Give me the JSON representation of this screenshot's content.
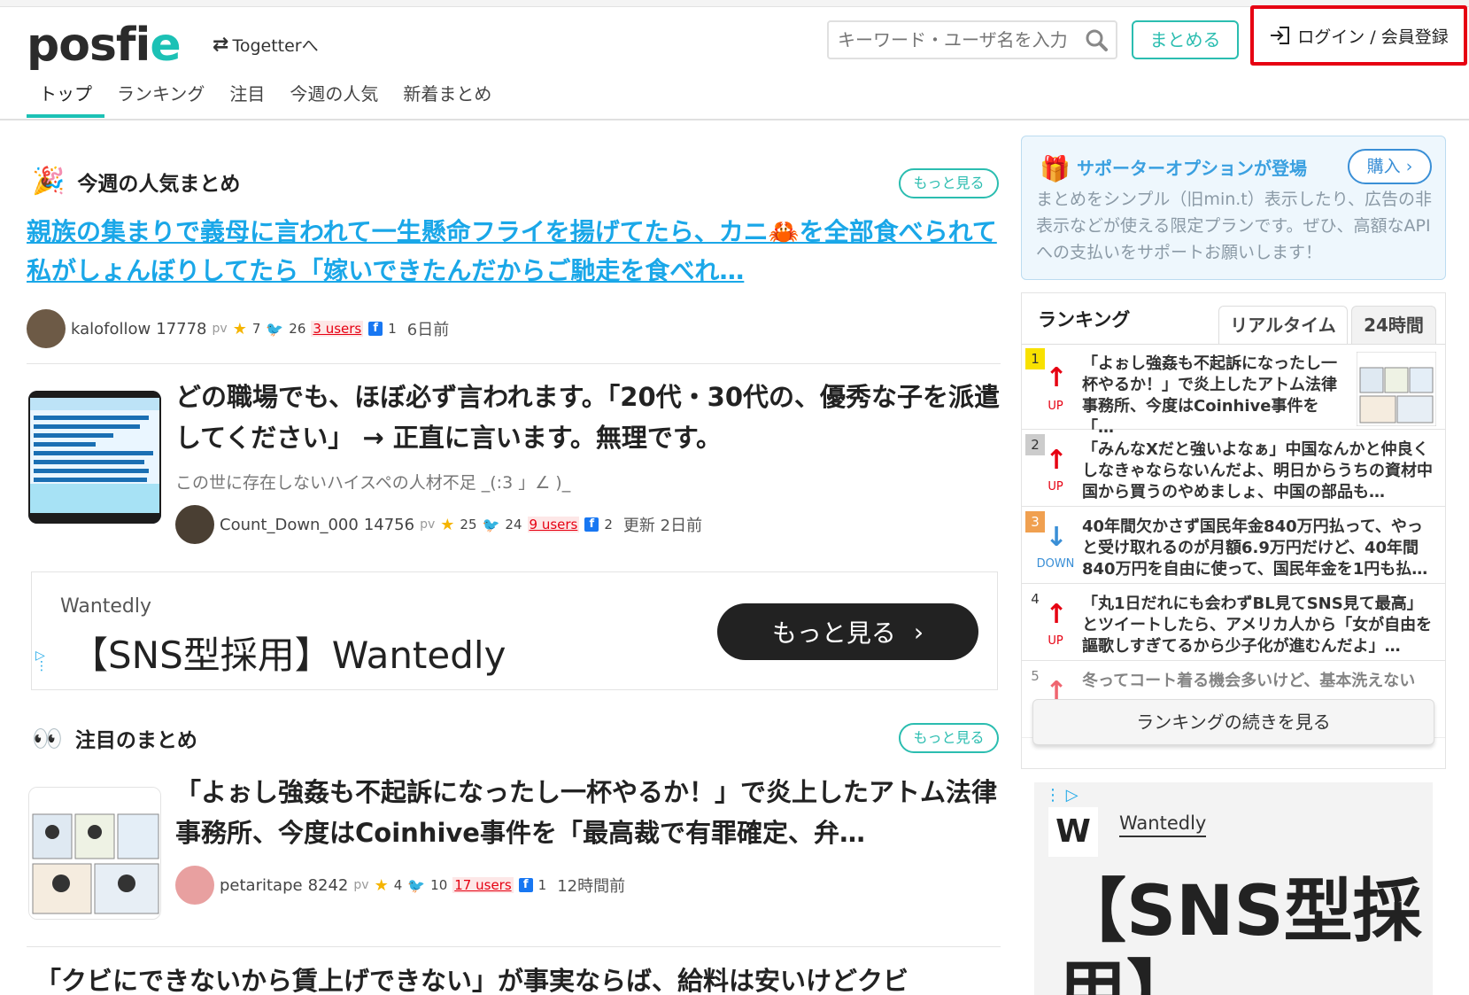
{
  "header": {
    "logo_text": "posfie",
    "togetter_link": "Togetterへ",
    "search_placeholder": "キーワード・ユーザ名を入力",
    "matome_button": "まとめる",
    "login_button": "ログイン / 会員登録",
    "nav_tabs": [
      "トップ",
      "ランキング",
      "注目",
      "今週の人気",
      "新着まとめ"
    ],
    "active_tab": "トップ"
  },
  "weekly": {
    "heading": "今週の人気まとめ",
    "more": "もっと見る",
    "feature": {
      "title": "親族の集まりで義母に言われて一生懸命フライを揚げてたら、カニ🦀を全部食べられて私がしょんぼりしてたら「嫁いできたんだからご馳走を食べれ…",
      "author": "kalofollow",
      "pv": "17778",
      "pv_unit": "pv",
      "stars": "7",
      "tweets": "26",
      "users": "3 users",
      "fb": "1",
      "time": "6日前"
    },
    "article": {
      "title": "どの職場でも、ほぼ必ず言われます。「20代・30代の、優秀な子を派遣してください」 → 正直に言います。無理です。",
      "desc": "この世に存在しないハイスペの人材不足 _(:3 」∠ )_",
      "author": "Count_Down_000",
      "pv": "14756",
      "pv_unit": "pv",
      "stars": "25",
      "tweets": "24",
      "users": "9 users",
      "fb": "2",
      "time": "更新 2日前"
    }
  },
  "ad_banner": {
    "brand": "Wantedly",
    "headline": "【SNS型採用】Wantedly",
    "cta": "もっと見る"
  },
  "attention": {
    "heading": "注目のまとめ",
    "more": "もっと見る",
    "article": {
      "title": "「よぉし強姦も不起訴になったし一杯やるか！」で炎上したアトム法律事務所、今度はCoinhive事件を「最高裁で有罪確定、弁…",
      "author": "petaritape",
      "pv": "8242",
      "pv_unit": "pv",
      "stars": "4",
      "tweets": "10",
      "users": "17 users",
      "fb": "1",
      "time": "12時間前"
    },
    "next_title": "「クビにできないから賃上げできない」が事実ならば、給料は安いけどクビ"
  },
  "supporter": {
    "title": "サポーターオプションが登場",
    "buy": "購入",
    "desc": "まとめをシンプル（旧min.t）表示したり、広告の非表示などが使える限定プランです。ぜひ、高額なAPIへの支払いをサポートお願いします！"
  },
  "ranking": {
    "title": "ランキング",
    "tab_realtime": "リアルタイム",
    "tab_24h": "24時間",
    "items": [
      {
        "rank": "1",
        "dir": "UP",
        "text": "「よぉし強姦も不起訴になったし一杯やるか！」で炎上したアトム法律事務所、今度はCoinhive事件を「…"
      },
      {
        "rank": "2",
        "dir": "UP",
        "text": "「みんなXだと強いよなぁ」中国なんかと仲良くしなきゃならないんだよ、明日からうちの資材中国から買うのやめましょ、中国の部品も…"
      },
      {
        "rank": "3",
        "dir": "DOWN",
        "text": "40年間欠かさず国民年金840万円払って、やっと受け取れるのが月額6.9万円だけど、40年間840万円を自由に使って、国民年金を1円も払…"
      },
      {
        "rank": "4",
        "dir": "UP",
        "text": "「丸1日だれにも会わずBL見てSNS見て最高」とツイートしたら、アメリカ人から「女が自由を謳歌しすぎてるから少子化が進むんだよ」…"
      },
      {
        "rank": "5",
        "dir": "UP",
        "text": "冬ってコート着る機会多いけど、基本洗えない"
      }
    ],
    "more": "ランキングの続きを見る"
  },
  "side_ad": {
    "brand": "Wantedly",
    "headline": "【SNS型採用】"
  },
  "colors": {
    "accent": "#1cc1b5",
    "link": "#1aa7e8",
    "login_border": "#e60012",
    "up": "#e60012",
    "down": "#3a8fd6"
  }
}
